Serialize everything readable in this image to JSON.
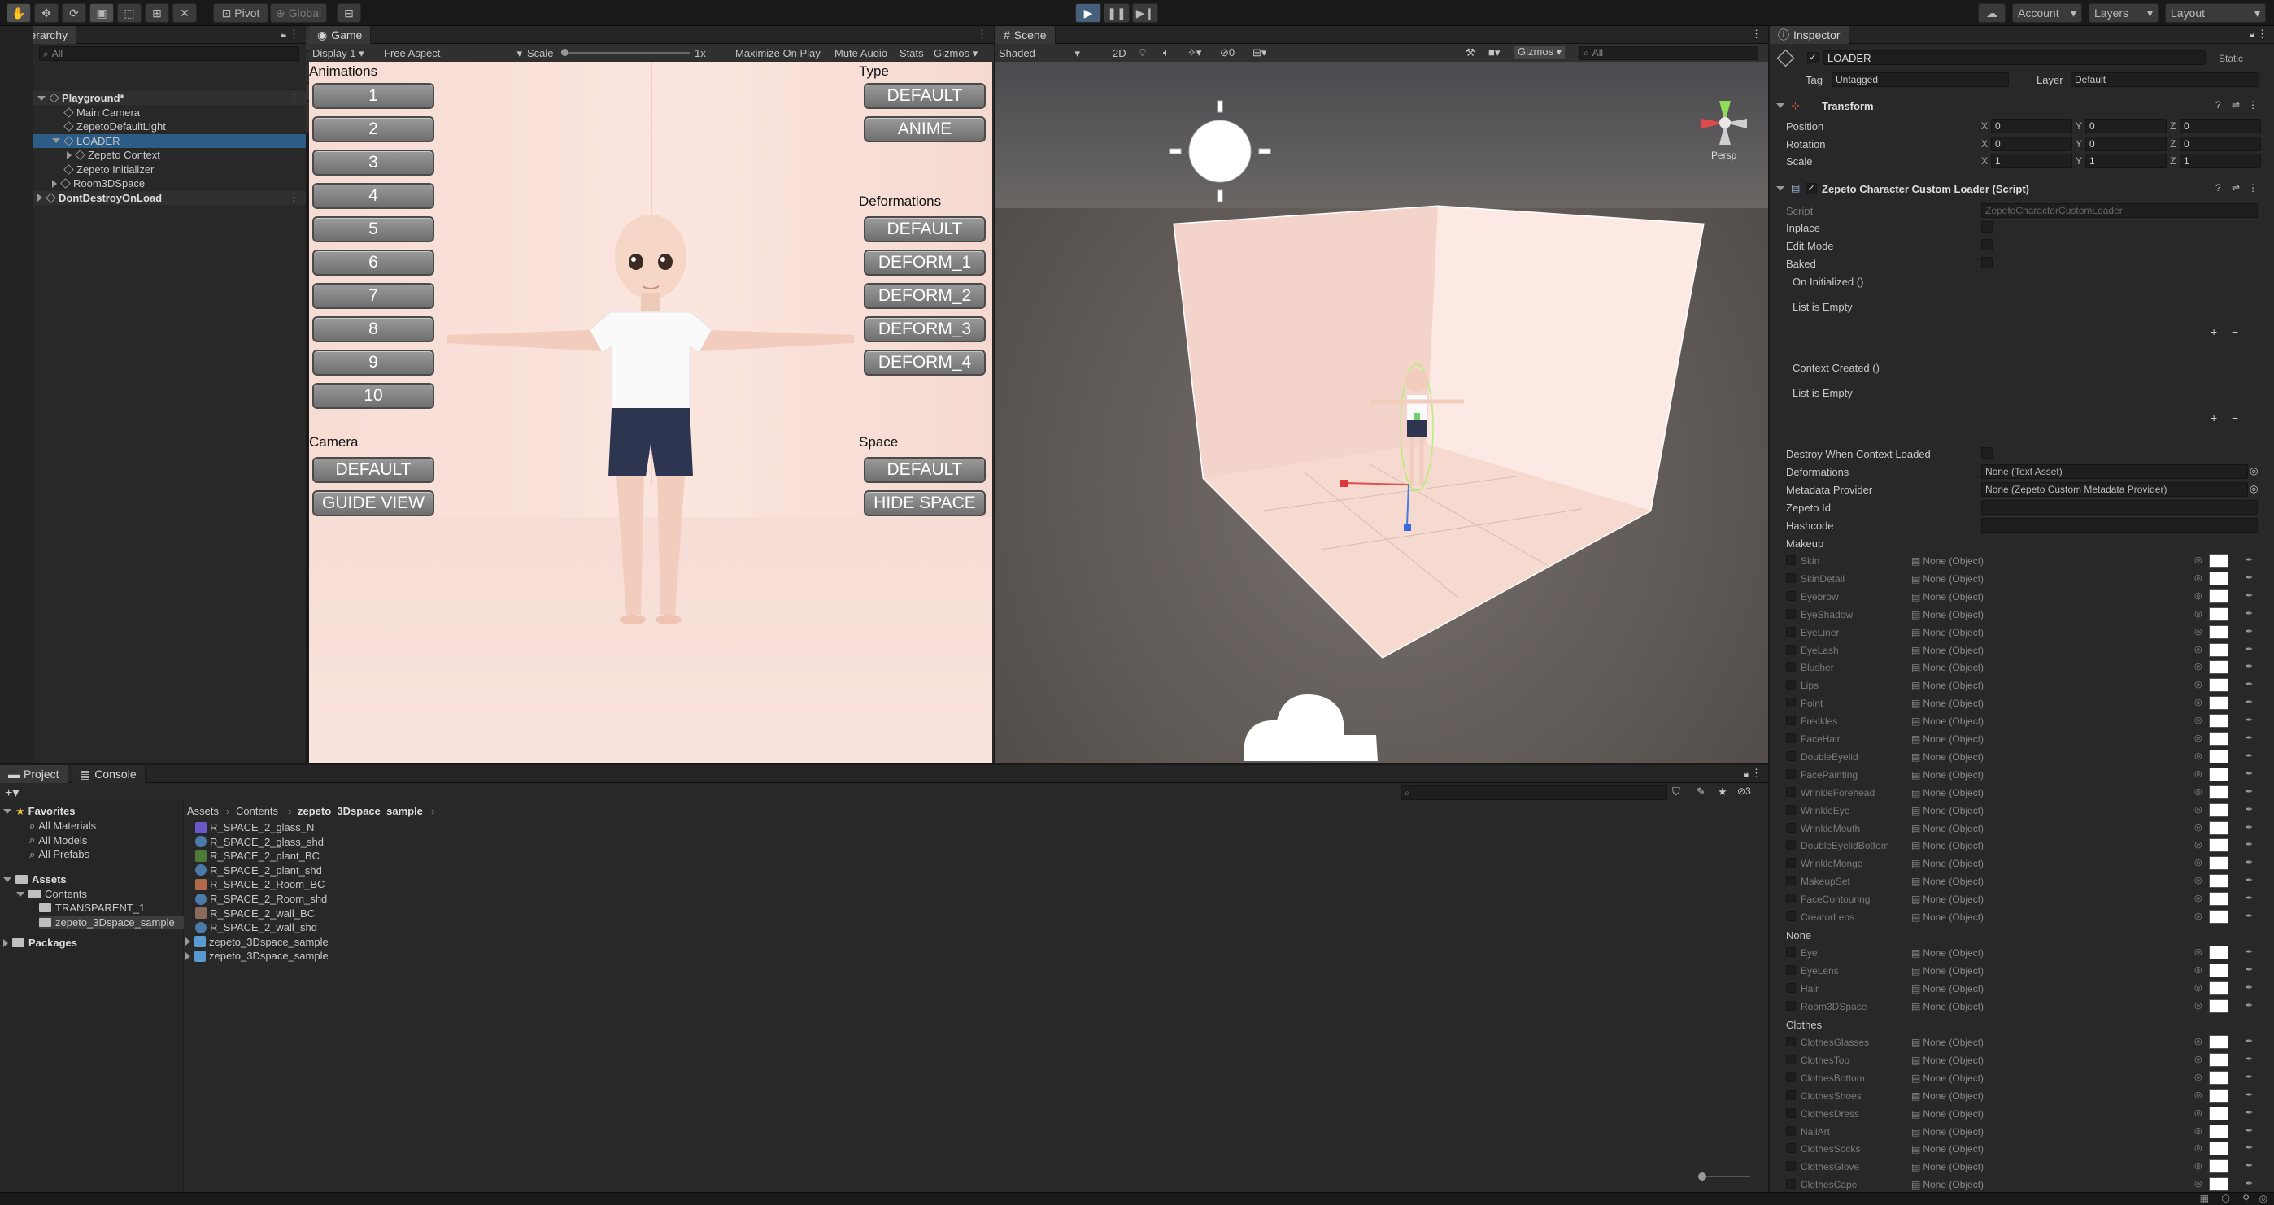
{
  "toolbar": {
    "pivot": "Pivot",
    "global": "Global",
    "account": "Account",
    "layers": "Layers",
    "layout": "Layout"
  },
  "hierarchy": {
    "tab": "Hierarchy",
    "search": "All",
    "items": [
      {
        "label": "Playground*",
        "indent": 0,
        "arrow": "down",
        "icon": "unity",
        "bold": true
      },
      {
        "label": "Main Camera",
        "indent": 1,
        "arrow": "",
        "icon": "cube"
      },
      {
        "label": "ZepetoDefaultLight",
        "indent": 1,
        "arrow": "",
        "icon": "cube"
      },
      {
        "label": "LOADER",
        "indent": 1,
        "arrow": "down",
        "icon": "cube",
        "selected": true
      },
      {
        "label": "Zepeto Context",
        "indent": 2,
        "arrow": "right",
        "icon": "cube"
      },
      {
        "label": "Zepeto Initializer",
        "indent": 1,
        "arrow": "",
        "icon": "cube"
      },
      {
        "label": "Room3DSpace",
        "indent": 1,
        "arrow": "right",
        "icon": "cube"
      },
      {
        "label": "DontDestroyOnLoad",
        "indent": 0,
        "arrow": "right",
        "icon": "unity",
        "bold": true
      }
    ]
  },
  "game": {
    "tab": "Game",
    "display": "Display 1",
    "aspect": "Free Aspect",
    "scale_label": "Scale",
    "scale_value": "1x",
    "maximize": "Maximize On Play",
    "mute": "Mute Audio",
    "stats": "Stats",
    "gizmos": "Gizmos",
    "animations_label": "Animations",
    "animations": [
      "1",
      "2",
      "3",
      "4",
      "5",
      "6",
      "7",
      "8",
      "9",
      "10"
    ],
    "type_label": "Type",
    "types": [
      "DEFAULT",
      "ANIME"
    ],
    "deform_label": "Deformations",
    "deforms": [
      "DEFAULT",
      "DEFORM_1",
      "DEFORM_2",
      "DEFORM_3",
      "DEFORM_4"
    ],
    "camera_label": "Camera",
    "cameras": [
      "DEFAULT",
      "GUIDE VIEW"
    ],
    "space_label": "Space",
    "spaces": [
      "DEFAULT",
      "HIDE SPACE"
    ]
  },
  "scene": {
    "tab": "Scene",
    "shading": "Shaded",
    "mode2d": "2D",
    "gizmos": "Gizmos",
    "search": "All",
    "persp": "Persp",
    "hidden_count": "0"
  },
  "inspector": {
    "tab": "Inspector",
    "object_name": "LOADER",
    "static": "Static",
    "tag_label": "Tag",
    "tag": "Untagged",
    "layer_label": "Layer",
    "layer": "Default",
    "transform_title": "Transform",
    "transform": [
      {
        "label": "Position",
        "x": "0",
        "y": "0",
        "z": "0"
      },
      {
        "label": "Rotation",
        "x": "0",
        "y": "0",
        "z": "0"
      },
      {
        "label": "Scale",
        "x": "1",
        "y": "1",
        "z": "1"
      }
    ],
    "script_title": "Zepeto Character Custom Loader (Script)",
    "script_label": "Script",
    "script_value": "ZepetoCharacterCustomLoader",
    "props": [
      "Inplace",
      "Edit Mode",
      "Baked"
    ],
    "event1": "On Initialized ()",
    "event2": "Context Created ()",
    "empty": "List is Empty",
    "destroy_label": "Destroy When Context Loaded",
    "deformations_label": "Deformations",
    "deformations_value": "None (Text Asset)",
    "metadata_label": "Metadata Provider",
    "metadata_value": "None (Zepeto Custom Metadata Provider)",
    "zepeto_id": "Zepeto Id",
    "hashcode": "Hashcode",
    "none_object": "None (Object)",
    "makeup_label": "Makeup",
    "makeup": [
      "Skin",
      "SkinDetail",
      "Eyebrow",
      "EyeShadow",
      "EyeLiner",
      "EyeLash",
      "Blusher",
      "Lips",
      "Point",
      "Freckles",
      "FaceHair",
      "DoubleEyelid",
      "FacePainting",
      "WrinkleForehead",
      "WrinkleEye",
      "WrinkleMouth",
      "DoubleEyelidBottom",
      "WrinkleMonge",
      "MakeupSet",
      "FaceContouring",
      "CreatorLens"
    ],
    "none_label": "None",
    "none_items": [
      "Eye",
      "EyeLens",
      "Hair",
      "Room3DSpace"
    ],
    "clothes_label": "Clothes",
    "clothes": [
      "ClothesGlasses",
      "ClothesTop",
      "ClothesBottom",
      "ClothesShoes",
      "ClothesDress",
      "NailArt",
      "ClothesSocks",
      "ClothesGlove",
      "ClothesCape"
    ]
  },
  "project": {
    "tab_project": "Project",
    "tab_console": "Console",
    "hidden_count": "3",
    "favorites_label": "Favorites",
    "favorites": [
      "All Materials",
      "All Models",
      "All Prefabs"
    ],
    "assets_label": "Assets",
    "contents": "Contents",
    "folders": [
      "TRANSPARENT_1",
      "zepeto_3Dspace_sample"
    ],
    "packages": "Packages",
    "breadcrumb": [
      "Assets",
      "Contents",
      "zepeto_3Dspace_sample"
    ],
    "files": [
      {
        "name": "R_SPACE_2_glass_N",
        "type": "tex",
        "color": "#6a58c8"
      },
      {
        "name": "R_SPACE_2_glass_shd",
        "type": "mat",
        "color": "#4a7aa8"
      },
      {
        "name": "R_SPACE_2_plant_BC",
        "type": "tex",
        "color": "#4f7a3a"
      },
      {
        "name": "R_SPACE_2_plant_shd",
        "type": "mat",
        "color": "#4a7aa8"
      },
      {
        "name": "R_SPACE_2_Room_BC",
        "type": "tex",
        "color": "#b06a4a"
      },
      {
        "name": "R_SPACE_2_Room_shd",
        "type": "mat",
        "color": "#4a7aa8"
      },
      {
        "name": "R_SPACE_2_wall_BC",
        "type": "tex",
        "color": "#8a6a5a"
      },
      {
        "name": "R_SPACE_2_wall_shd",
        "type": "mat",
        "color": "#4a7aa8"
      },
      {
        "name": "zepeto_3Dspace_sample",
        "type": "prefab",
        "color": "#5a9ad0"
      },
      {
        "name": "zepeto_3Dspace_sample",
        "type": "prefab",
        "color": "#5a9ad0"
      }
    ]
  }
}
